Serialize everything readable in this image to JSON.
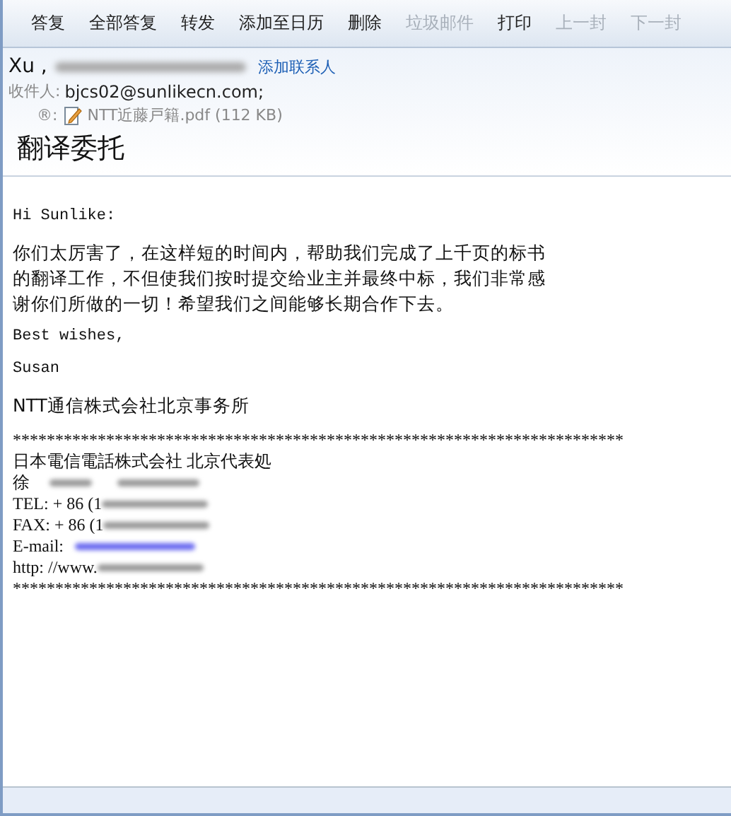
{
  "toolbar": [
    {
      "label": "答复",
      "disabled": false
    },
    {
      "label": "全部答复",
      "disabled": false
    },
    {
      "label": "转发",
      "disabled": false
    },
    {
      "label": "添加至日历",
      "disabled": false
    },
    {
      "label": "删除",
      "disabled": false
    },
    {
      "label": "垃圾邮件",
      "disabled": true
    },
    {
      "label": "打印",
      "disabled": false
    },
    {
      "label": "上一封",
      "disabled": true
    },
    {
      "label": "下一封",
      "disabled": true
    }
  ],
  "header": {
    "sender": "Xu ,",
    "add_contact": "添加联系人",
    "to_label": "收件人:",
    "to": "bjcs02@sunlikecn.com;",
    "attachment_mark": "®:",
    "attachment": "NTT近藤戸籍.pdf (112 KB)",
    "subject": "翻译委托"
  },
  "body": [
    {
      "kind": "mono",
      "text": "Hi Sunlike:"
    },
    {
      "kind": "para",
      "text": "你们太厉害了，在这样短的时间内，帮助我们完成了上千页的标书的翻译工作，不但使我们按时提交给业主并最终中标，我们非常感谢你们所做的一切！希望我们之间能够长期合作下去。"
    },
    {
      "kind": "mono",
      "text": "Best wishes,"
    },
    {
      "kind": "mono",
      "text": "Susan"
    },
    {
      "kind": "para",
      "text": "NTT通信株式会社北京事务所"
    }
  ],
  "signature": [
    {
      "text": "************************************************************************",
      "kind": "text"
    },
    {
      "text": "日本電信電話株式会社  北京代表処",
      "kind": "text"
    },
    {
      "text": "徐",
      "kind": "name"
    },
    {
      "text": "TEL:  + 86 (1",
      "kind": "redacted"
    },
    {
      "text": "FAX:  + 86 (1",
      "kind": "redacted"
    },
    {
      "text": "E-mail:",
      "kind": "link"
    },
    {
      "text": "http: //www.",
      "kind": "redacted"
    },
    {
      "text": "************************************************************************",
      "kind": "text"
    }
  ]
}
